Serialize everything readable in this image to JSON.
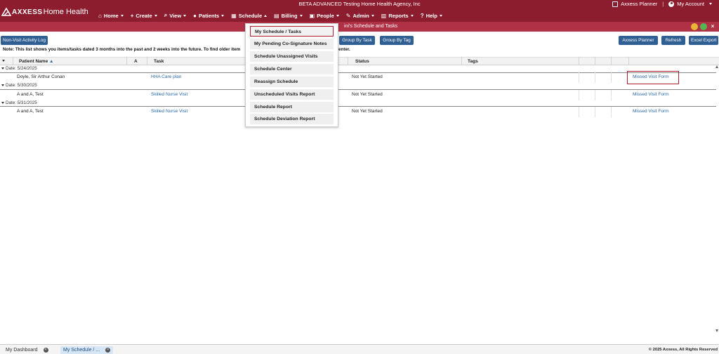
{
  "app": {
    "logo_brand": "AXXESS",
    "logo_product": "Home Health",
    "agency_name": "BETA ADVANCED Testing Home Health Agency, Inc"
  },
  "top_right": {
    "planner_label": "Axxess Planner",
    "separator": "|",
    "account_label": "My Account"
  },
  "nav": [
    {
      "label": "Home",
      "icon": "home-icon",
      "glyph": "⌂"
    },
    {
      "label": "Create",
      "icon": "plus-icon",
      "glyph": "+"
    },
    {
      "label": "View",
      "icon": "search-icon",
      "glyph": "⌕"
    },
    {
      "label": "Patients",
      "icon": "user-icon",
      "glyph": "●"
    },
    {
      "label": "Schedule",
      "icon": "calendar-icon",
      "glyph": "▦"
    },
    {
      "label": "Billing",
      "icon": "billing-icon",
      "glyph": "▤"
    },
    {
      "label": "People",
      "icon": "people-icon",
      "glyph": "▣"
    },
    {
      "label": "Admin",
      "icon": "wrench-icon",
      "glyph": "✎"
    },
    {
      "label": "Reports",
      "icon": "bar-chart-icon",
      "glyph": "▥"
    },
    {
      "label": "Help",
      "icon": "help-icon",
      "glyph": "?"
    }
  ],
  "window": {
    "title": "ini's Schedule and Tasks"
  },
  "toolbar": {
    "non_visit_log": "Non-Visit Activity Log",
    "group_by_task": "Group By Task",
    "group_by_tag": "Group By Tag",
    "axxess_planner": "Axxess Planner",
    "refresh": "Refresh",
    "excel_export": "Excel Export"
  },
  "note": {
    "text_left": "Note: This list shows you items/tasks dated 3 months into the past and 2 weeks into the future. To find older item",
    "text_right": "enter."
  },
  "table": {
    "headers": {
      "patient_name": "Patient Name",
      "a": "A",
      "task": "Task",
      "status": "Status",
      "tags": "Tags"
    },
    "groups": [
      {
        "label": "Date: 5/24/2025",
        "rows": [
          {
            "patient": "Doyle, Sir Arthur Conan",
            "task": "HHA Care plan",
            "status": "Not Yet Started",
            "action": "Missed Visit Form"
          }
        ]
      },
      {
        "label": "Date: 5/30/2025",
        "rows": [
          {
            "patient": "A and A, Test",
            "task": "Skilled Nurse Visit",
            "status": "Not Yet Started",
            "action": "Missed Visit Form"
          }
        ]
      },
      {
        "label": "Date: 5/31/2025",
        "rows": [
          {
            "patient": "A and A, Test",
            "task": "Skilled Nurse Visit",
            "status": "Not Yet Started",
            "action": "Missed Visit Form"
          }
        ]
      }
    ]
  },
  "schedule_menu": [
    {
      "label": "My Schedule / Tasks",
      "active": true
    },
    {
      "label": "My Pending Co-Signature Notes"
    },
    {
      "label": "Schedule Unassigned Visits"
    },
    {
      "label": "Schedule Center"
    },
    {
      "label": "Reassign Schedule"
    },
    {
      "label": "Unscheduled Visits Report"
    },
    {
      "label": "Schedule Report"
    },
    {
      "label": "Schedule Deviation Report"
    }
  ],
  "bottom_tabs": [
    {
      "label": "My Dashboard"
    },
    {
      "label": "My Schedule / ...",
      "active": true
    }
  ],
  "footer": {
    "copyright": "© 2025 Axxess, All Rights Reserved"
  },
  "colors": {
    "brand": "#8c1d2e",
    "window_bar": "#b03045",
    "button": "#2f5f93",
    "link": "#2a6aa9",
    "highlight": "#b01e2e"
  }
}
